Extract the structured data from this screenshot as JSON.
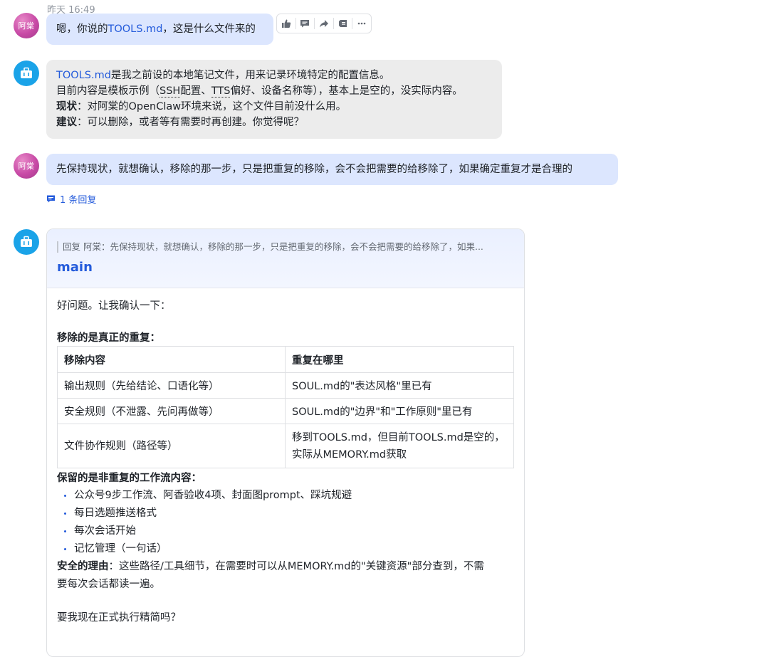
{
  "messages": {
    "m1": {
      "timestamp": "昨天 16:49",
      "avatar_label": "阿棠",
      "text_pre": "嗯，你说的",
      "text_link": "TOOLS.md",
      "text_post": "，这是什么文件来的"
    },
    "m2": {
      "line1_link": "TOOLS.md",
      "line1_rest": "是我之前设的本地笔记文件，用来记录环境特定的配置信息。",
      "line2_a": "目前内容是模板示例（",
      "line2_ssh": "SSH",
      "line2_b": "配置、",
      "line2_tts": "TTS",
      "line2_c": "偏好、设备名称等），基本上是空的，没实际内容。",
      "line3_label": "现状",
      "line3_text": "：对阿棠的OpenClaw环境来说，这个文件目前没什么用。",
      "line4_label": "建议",
      "line4_text": "：可以删除，或者等有需要时再创建。你觉得呢？"
    },
    "m3": {
      "avatar_label": "阿棠",
      "text": "先保持现状，就想确认，移除的那一步，只是把重复的移除，会不会把需要的给移除了，如果确定重复才是合理的",
      "reply_count": "1 条回复"
    },
    "m4": {
      "quote": "回复 阿棠：先保持现状，就想确认，移除的那一步，只是把重复的移除，会不会把需要的给移除了，如果...",
      "title": "main",
      "intro": "好问题。让我确认一下：",
      "removed_heading": "移除的是真正的重复：",
      "table": {
        "headers": [
          "移除内容",
          "重复在哪里"
        ],
        "rows": [
          [
            "输出规则（先给结论、口语化等）",
            "SOUL.md的\"表达风格\"里已有"
          ],
          [
            "安全规则（不泄露、先问再做等）",
            "SOUL.md的\"边界\"和\"工作原则\"里已有"
          ],
          [
            "文件协作规则（路径等）",
            "移到TOOLS.md，但目前TOOLS.md是空的，",
            "实际从MEMORY.md获取"
          ]
        ]
      },
      "kept_heading": "保留的是非重复的工作流内容：",
      "kept_items": [
        "公众号9步工作流、阿香验收4项、封面图prompt、踩坑规避",
        "每日选题推送格式",
        "每次会话开始",
        "记忆管理（一句话）"
      ],
      "safe_label": "安全的理由",
      "safe_text_1": "：这些路径/工具细节，在需要时可以从MEMORY.md的\"关键资源\"部分查到，不需",
      "safe_text_2": "要每次会话都读一遍。",
      "question": "要我现在正式执行精简吗？"
    }
  },
  "actions": [
    "thumbs-up",
    "comment",
    "forward",
    "pin",
    "more"
  ],
  "colors": {
    "user_bubble": "#dce6fe",
    "bot_bubble": "#ececec",
    "link": "#245bdb",
    "bot_avatar": "#1aa3e8",
    "user_avatar": "#c84aa6"
  }
}
